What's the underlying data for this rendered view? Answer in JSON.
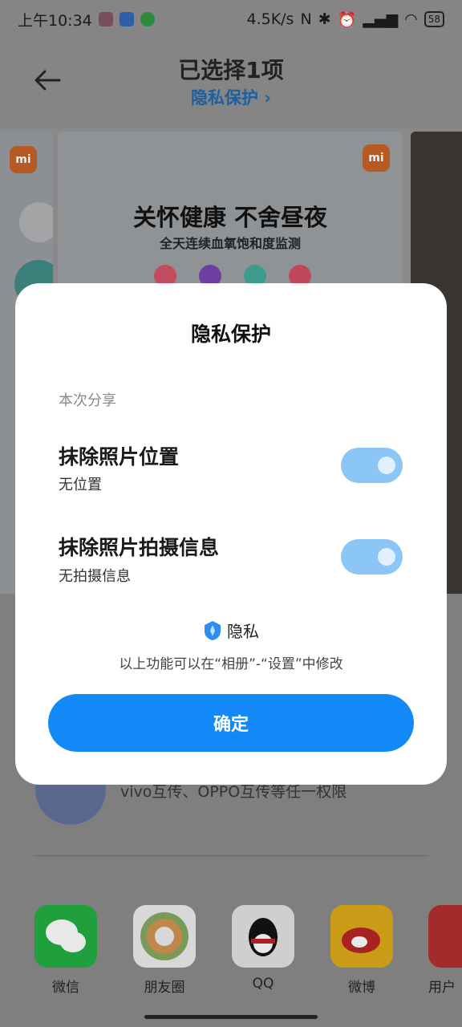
{
  "status_bar": {
    "time": "上午10:34",
    "net_speed": "4.5K/s",
    "battery": "58"
  },
  "header": {
    "title": "已选择1项",
    "subtitle": "隐私保护 ›"
  },
  "carousel": {
    "card_headline": "关怀健康 不舍昼夜",
    "card_sub": "全天连续血氧饱和度监测",
    "mi_logo": "mi",
    "dot_colors": [
      "#c24b60",
      "#6d3fa0",
      "#3d9a8c",
      "#c0485a"
    ]
  },
  "background": {
    "share_text": "vivo互传、OPPO互传等任一权限",
    "share_apps": [
      {
        "label": "微信",
        "icon": "wechat-icon",
        "color": "#1fa03c"
      },
      {
        "label": "朋友圈",
        "icon": "moments-icon",
        "color": "#d8d8d8"
      },
      {
        "label": "QQ",
        "icon": "qq-icon",
        "color": "#cfcfcf"
      },
      {
        "label": "微博",
        "icon": "weibo-icon",
        "color": "#c99b16"
      },
      {
        "label": "用户",
        "icon": "app-icon",
        "color": "#a32b2b"
      }
    ]
  },
  "modal": {
    "title": "隐私保护",
    "section_label": "本次分享",
    "options": [
      {
        "title": "抹除照片位置",
        "subtitle": "无位置",
        "enabled": true
      },
      {
        "title": "抹除照片拍摄信息",
        "subtitle": "无拍摄信息",
        "enabled": true
      }
    ],
    "brand_text": "隐私",
    "hint": "以上功能可以在“相册”-“设置”中修改",
    "confirm_label": "确定",
    "accent_color": "#1289f7"
  }
}
